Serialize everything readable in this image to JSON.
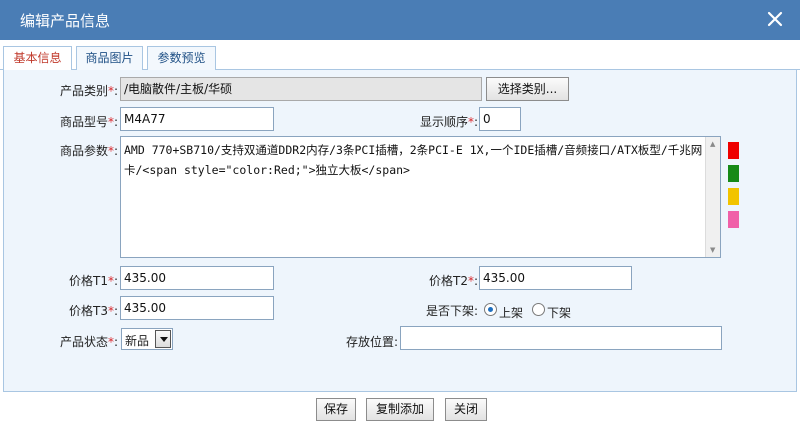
{
  "dialog": {
    "title": "编辑产品信息",
    "close_icon": "close-icon"
  },
  "tabs": [
    {
      "label": "基本信息",
      "active": true
    },
    {
      "label": "商品图片",
      "active": false
    },
    {
      "label": "参数预览",
      "active": false
    }
  ],
  "form": {
    "category": {
      "label": "产品类别",
      "value": "/电脑散件/主板/华硕",
      "button": "选择类别..."
    },
    "model": {
      "label": "商品型号",
      "value": "M4A77"
    },
    "display_order": {
      "label": "显示顺序",
      "value": "0"
    },
    "params": {
      "label": "商品参数",
      "value": "AMD 770+SB710/支持双通道DDR2内存/3条PCI插槽，2条PCI-E 1X,一个IDE插槽/音频接口/ATX板型/千兆网卡/<span style=\"color:Red;\">独立大板</span>"
    },
    "color_swatches": [
      "#ee0000",
      "#178a17",
      "#f2c400",
      "#f060a8"
    ],
    "price_t1": {
      "label": "价格T1",
      "value": "435.00"
    },
    "price_t2": {
      "label": "价格T2",
      "value": "435.00"
    },
    "price_t3": {
      "label": "价格T3",
      "value": "435.00"
    },
    "offshelf": {
      "label": "是否下架",
      "options": [
        "上架",
        "下架"
      ],
      "selected": "上架"
    },
    "status": {
      "label": "产品状态",
      "value": "新品"
    },
    "storage": {
      "label": "存放位置",
      "value": ""
    }
  },
  "footer": {
    "save": "保存",
    "copy_add": "复制添加",
    "close": "关闭"
  },
  "labels": {
    "required_mark": "*",
    "colon": ":"
  }
}
